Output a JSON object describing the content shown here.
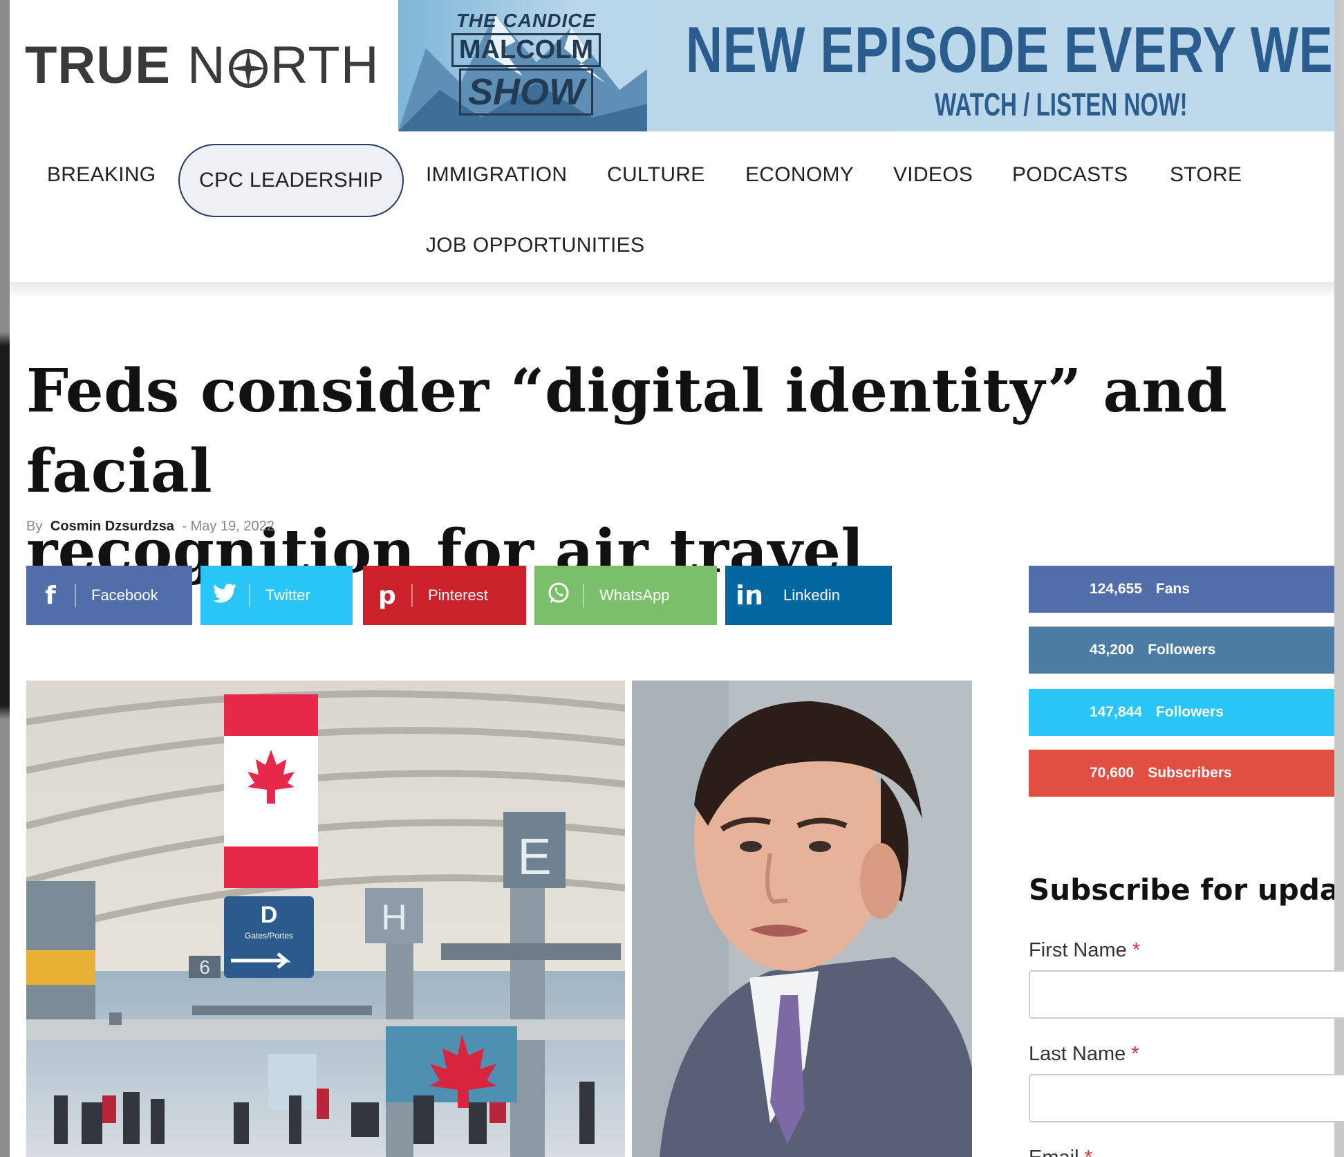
{
  "site": {
    "logo_true": "TRUE",
    "logo_north": "N",
    "logo_north_rest": "RTH"
  },
  "banner": {
    "show_line1": "THE CANDICE",
    "show_line2": "MALCOLM",
    "show_line3": "SHOW",
    "title": "NEW EPISODE EVERY WEEK",
    "subtitle": "WATCH / LISTEN NOW!"
  },
  "nav": {
    "items": [
      "BREAKING",
      "CPC LEADERSHIP",
      "IMMIGRATION",
      "CULTURE",
      "ECONOMY",
      "VIDEOS",
      "PODCASTS",
      "STORE",
      "JOB OPPORTUNITIES"
    ],
    "active": "CPC LEADERSHIP"
  },
  "article": {
    "title_line1": "Feds consider “digital identity” and facial",
    "title_line2": "recognition for air travel",
    "by": "By",
    "author": "Cosmin Dzsurdzsa",
    "date_sep": "-",
    "date": "May 19, 2022"
  },
  "share": [
    {
      "label": "Facebook",
      "icon": "f",
      "color": "#516eab"
    },
    {
      "label": "Twitter",
      "icon": "t",
      "color": "#29c5f6"
    },
    {
      "label": "Pinterest",
      "icon": "p",
      "color": "#ca212a"
    },
    {
      "label": "WhatsApp",
      "icon": "w",
      "color": "#7bbf6a"
    },
    {
      "label": "Linkedin",
      "icon": "in",
      "color": "#0266a0"
    }
  ],
  "images": {
    "airport_sign_letter": "D",
    "airport_sign_text": "Gates/Portes",
    "airport_gate_h": "H",
    "airport_gate_e": "E",
    "airport_gate_6": "6"
  },
  "counters": [
    {
      "value": "124,655",
      "unit": "Fans",
      "color": "#516eab"
    },
    {
      "value": "43,200",
      "unit": "Followers",
      "color": "#4c7ba3"
    },
    {
      "value": "147,844",
      "unit": "Followers",
      "color": "#29c5f6"
    },
    {
      "value": "70,600",
      "unit": "Subscribers",
      "color": "#e14e42"
    }
  ],
  "subscribe": {
    "title": "Subscribe for updates",
    "first_name": "First Name",
    "last_name": "Last Name",
    "email": "Email",
    "required_mark": "*"
  }
}
